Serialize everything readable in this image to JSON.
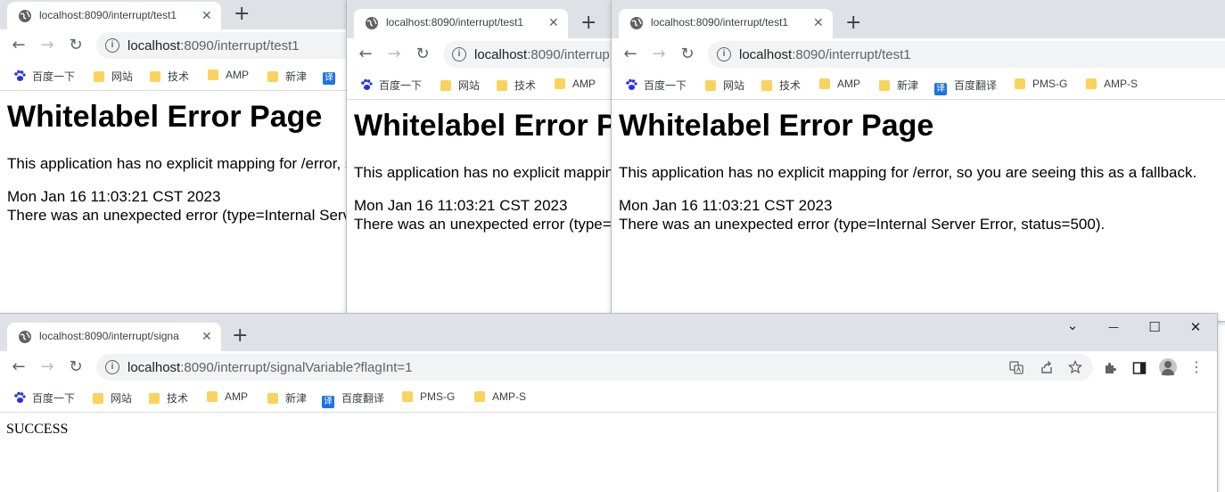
{
  "windows": [
    {
      "tab_title": "localhost:8090/interrupt/test1",
      "tab_close": "✕",
      "new_tab": "+",
      "url_host": "localhost",
      "url_path": ":8090/interrupt/test1",
      "bookmarks": [
        "百度一下",
        "网站",
        "技术",
        "AMP",
        "新津",
        "译"
      ]
    },
    {
      "tab_title": "localhost:8090/interrupt/test1",
      "tab_close": "✕",
      "new_tab": "+",
      "url_host": "localhost",
      "url_path": ":8090/interrup",
      "bookmarks": [
        "百度一下",
        "网站",
        "技术",
        "AMP"
      ]
    },
    {
      "tab_title": "localhost:8090/interrupt/test1",
      "tab_close": "✕",
      "new_tab": "+",
      "url_host": "localhost",
      "url_path": ":8090/interrupt/test1",
      "bookmarks": [
        "百度一下",
        "网站",
        "技术",
        "AMP",
        "新津",
        "百度翻译",
        "PMS-G",
        "AMP-S"
      ]
    },
    {
      "tab_title": "localhost:8090/interrupt/signa",
      "tab_close": "✕",
      "new_tab": "+",
      "url_host": "localhost",
      "url_path": ":8090/interrupt/signalVariable?flagInt=1",
      "bookmarks": [
        "百度一下",
        "网站",
        "技术",
        "AMP",
        "新津",
        "百度翻译",
        "PMS-G",
        "AMP-S"
      ]
    }
  ],
  "error_page": {
    "heading": "Whitelabel Error Page",
    "message": "This application has no explicit mapping for /error, so you are seeing this as a fallback.",
    "timestamp": "Mon Jan 16 11:03:21 CST 2023",
    "detail": "There was an unexpected error (type=Internal Server Error, status=500)."
  },
  "success_text": "SUCCESS",
  "nav": {
    "back": "←",
    "forward": "→",
    "reload": "↻",
    "info": "i"
  },
  "window_controls": {
    "chevron": "⌄",
    "minimize": "—",
    "maximize": "☐",
    "close": "✕"
  },
  "icons": {
    "translate": "translate-icon",
    "share": "share-icon",
    "star": "star-icon",
    "extensions": "puzzle-icon",
    "sidepanel": "side-panel-icon",
    "menu": "kebab-menu-icon"
  },
  "colors": {
    "tabstrip": "#dee1e6",
    "omnibox": "#f1f3f4",
    "folder": "#f9d35b",
    "translate_badge": "#1a73e8"
  }
}
